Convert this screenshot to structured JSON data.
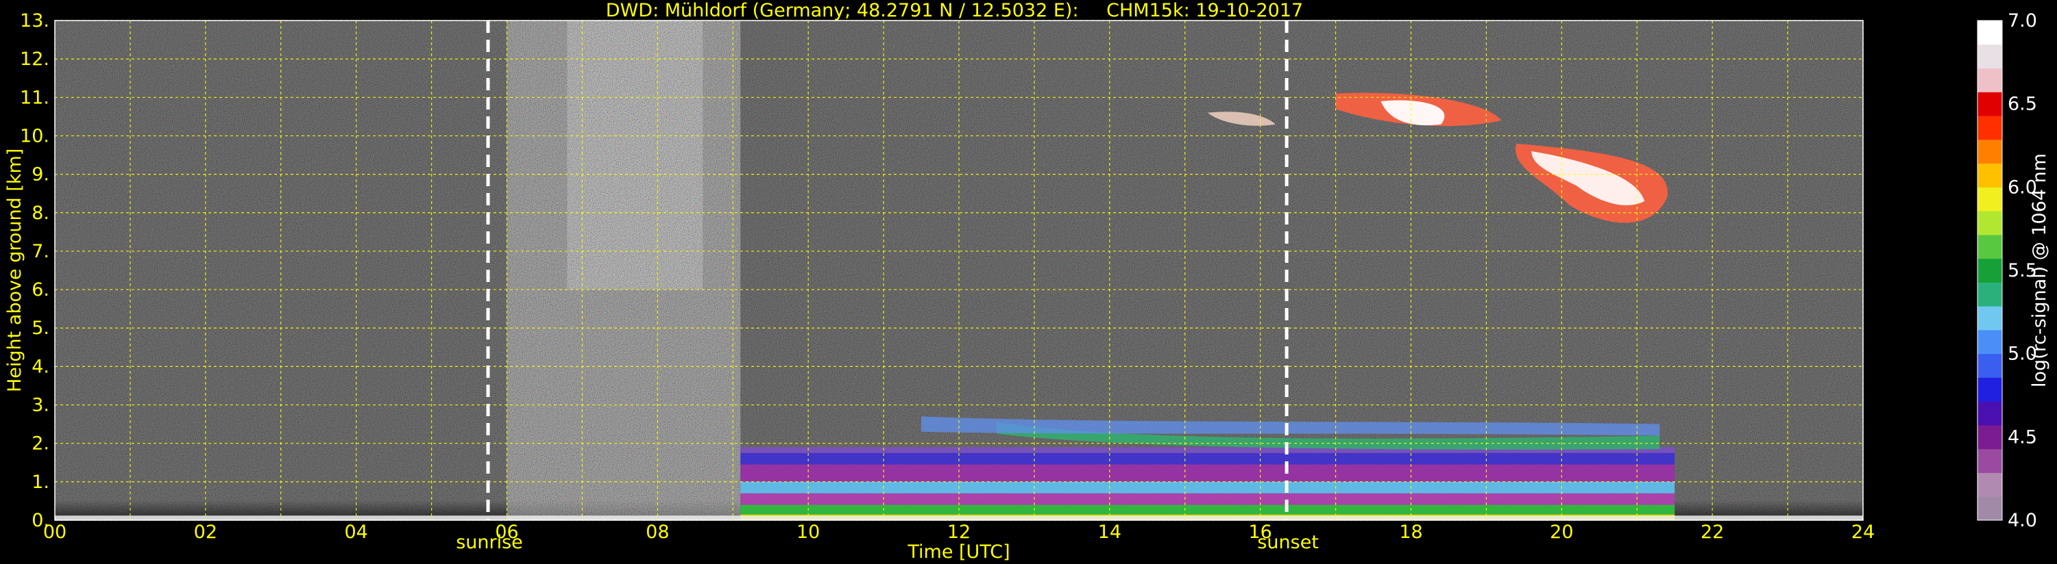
{
  "title_left": "DWD: Mühldorf (Germany; 48.2791 N / 12.5032 E):",
  "title_right": "CHM15k: 19-10-2017",
  "chart_data": {
    "type": "heatmap",
    "title": "DWD: Mühldorf (Germany; 48.2791 N / 12.5032 E):    CHM15k: 19-10-2017",
    "xlabel": "Time [UTC]",
    "ylabel": "Height above ground [km]",
    "colorbar_label": "log(rc-signal) @ 1064 nm",
    "x_range": [
      0,
      24
    ],
    "y_range": [
      0,
      13
    ],
    "x_ticks": [
      "00",
      "02",
      "04",
      "06",
      "08",
      "10",
      "12",
      "14",
      "16",
      "18",
      "20",
      "22",
      "24"
    ],
    "y_ticks": [
      "0.",
      "1.",
      "2.",
      "3.",
      "4.",
      "5.",
      "6.",
      "7.",
      "8.",
      "9.",
      "10.",
      "11.",
      "12.",
      "13."
    ],
    "colorbar_range": [
      4.0,
      7.0
    ],
    "colorbar_ticks": [
      "4.0",
      "4.5",
      "5.0",
      "5.5",
      "6.0",
      "6.5",
      "7.0"
    ],
    "grid": true,
    "grid_color": "#ffff00",
    "events": [
      {
        "label": "sunrise",
        "time": 5.75
      },
      {
        "label": "sunset",
        "time": 16.35
      }
    ],
    "features": [
      {
        "name": "boundary layer aerosol",
        "x_start": 9.1,
        "x_end": 21.5,
        "y_top": 1.9
      },
      {
        "name": "elevated aerosol layer",
        "x_start": 12.5,
        "x_end": 21.3,
        "y": 2.0
      },
      {
        "name": "cirrus cloud",
        "x_start": 15.3,
        "x_end": 21.5,
        "y_start": 7.5,
        "y_end": 11.2
      }
    ],
    "colormap": [
      "#a08aa8",
      "#b18ab1",
      "#9a4aa0",
      "#7a1c90",
      "#4a0fb0",
      "#2020e0",
      "#3a5ef0",
      "#4a8ff8",
      "#70c8f0",
      "#2ab07a",
      "#18a038",
      "#58c840",
      "#b0e830",
      "#f0f020",
      "#ffc000",
      "#ff8000",
      "#ff3000",
      "#e00000",
      "#f0c0c8",
      "#e8e0e4",
      "#ffffff"
    ]
  }
}
